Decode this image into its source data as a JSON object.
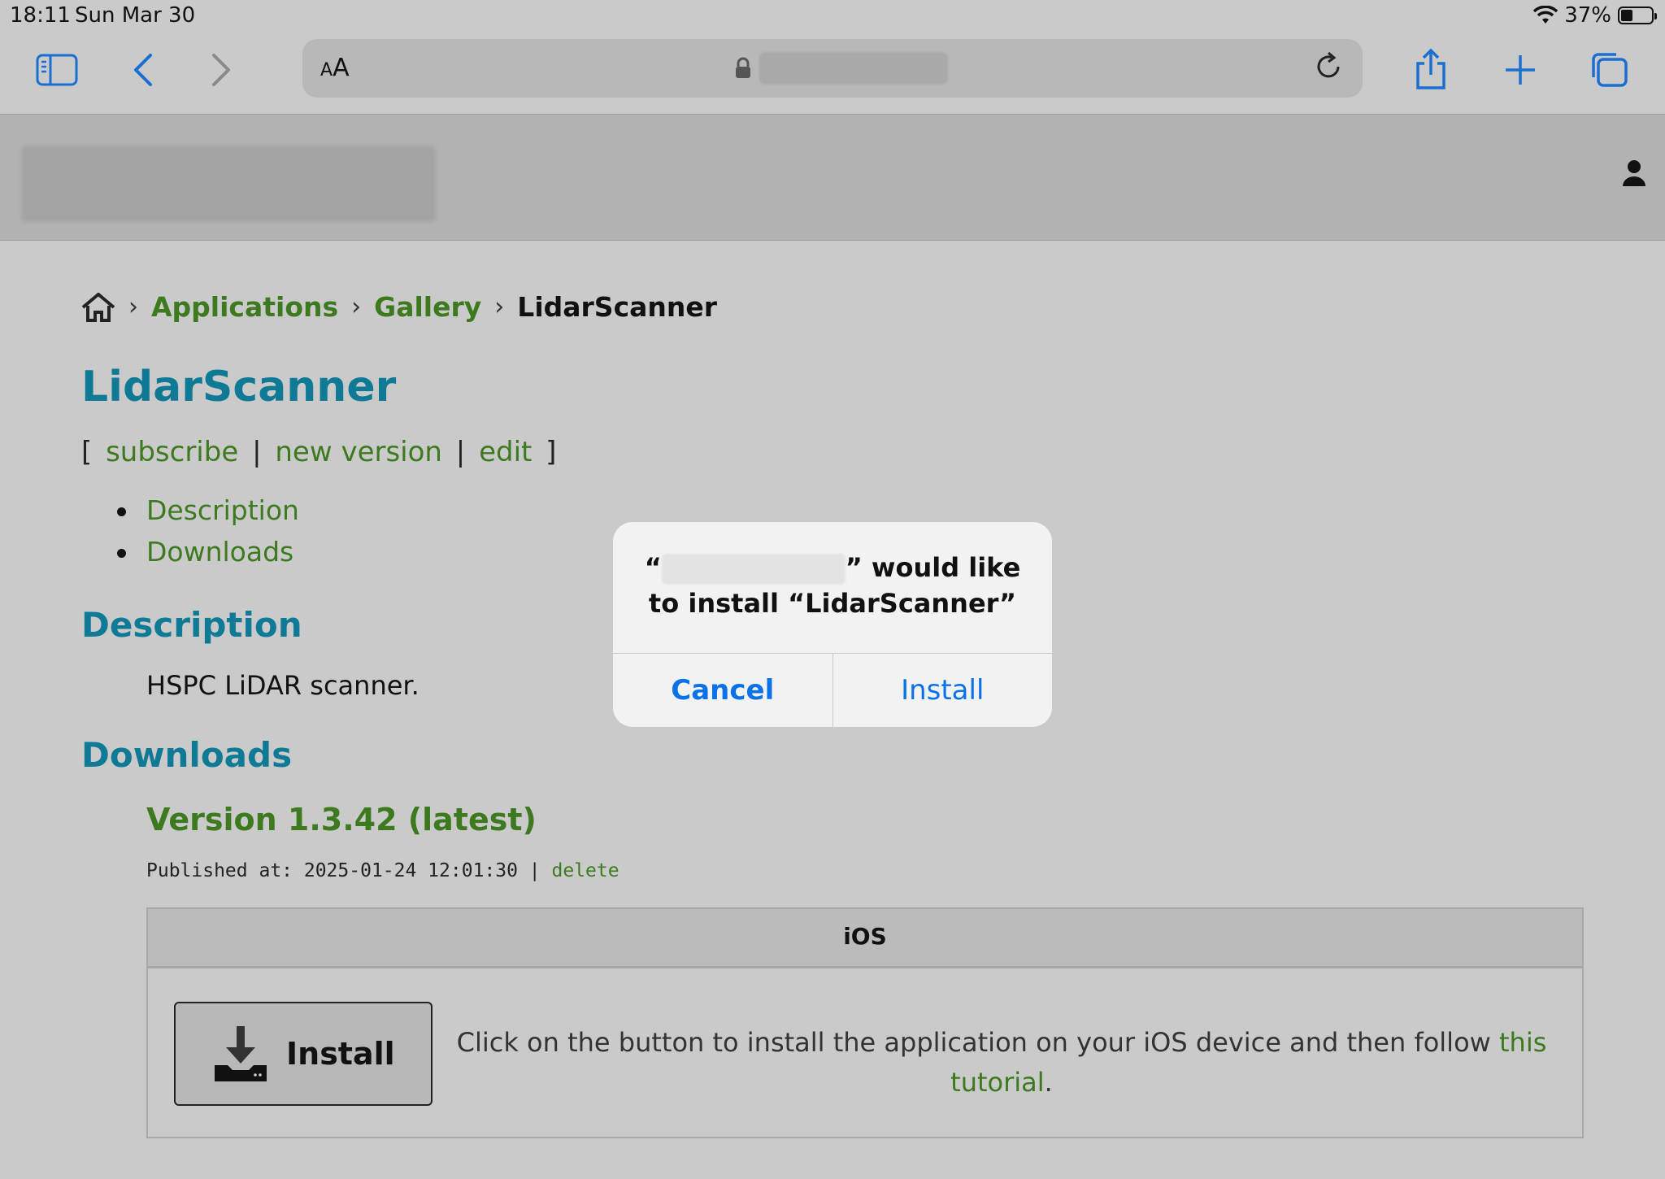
{
  "status_bar": {
    "time": "18:11",
    "date": "Sun Mar 30",
    "battery": "37%"
  },
  "toolbar": {
    "reader_label_small": "A",
    "reader_label_large": "A"
  },
  "breadcrumb": {
    "applications": "Applications",
    "gallery": "Gallery",
    "current": "LidarScanner",
    "separator": "›"
  },
  "page": {
    "title": "LidarScanner",
    "actions": {
      "open": "[",
      "subscribe": "subscribe",
      "sep": "|",
      "new_version": "new version",
      "edit": "edit",
      "close": "]"
    },
    "toc": [
      "Description",
      "Downloads"
    ],
    "description_heading": "Description",
    "description_text": "HSPC LiDAR scanner.",
    "downloads_heading": "Downloads",
    "version": "Version 1.3.42 (latest)",
    "published": "Published at: 2025-01-24 12:01:30 |",
    "delete": "delete"
  },
  "table": {
    "header": "iOS",
    "install_label": "Install",
    "instruction": "Click on the button to install the application on your iOS device and then follow",
    "tutorial_link": "this tutorial",
    "period": "."
  },
  "dialog": {
    "open_quote": "“",
    "message_part": "” would like to install “LidarScanner”",
    "cancel": "Cancel",
    "install": "Install"
  }
}
